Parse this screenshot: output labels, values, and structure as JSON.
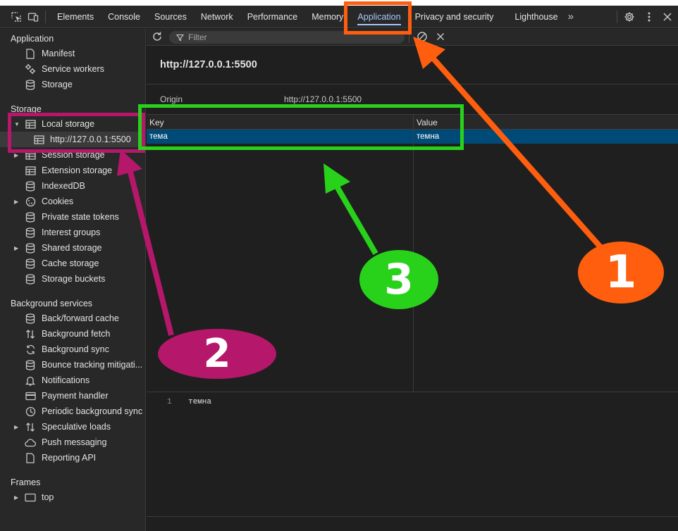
{
  "tabs": [
    {
      "label": "Elements"
    },
    {
      "label": "Console"
    },
    {
      "label": "Sources"
    },
    {
      "label": "Network"
    },
    {
      "label": "Performance"
    },
    {
      "label": "Memory"
    },
    {
      "label": "Application",
      "active": true
    },
    {
      "label": "Privacy and security"
    },
    {
      "label": "Lighthouse"
    }
  ],
  "toolbar": {
    "more_tabs": "»",
    "settings_icon": "gear-icon",
    "menu_icon": "vertical-dots-icon",
    "close_icon": "close-icon"
  },
  "sidebar": {
    "application_title": "Application",
    "application_items": [
      {
        "label": "Manifest",
        "icon": "file-icon"
      },
      {
        "label": "Service workers",
        "icon": "gears-icon"
      },
      {
        "label": "Storage",
        "icon": "database-icon"
      }
    ],
    "storage_title": "Storage",
    "storage_items": [
      {
        "label": "Local storage",
        "icon": "table-icon",
        "expanded": true
      },
      {
        "label": "http://127.0.0.1:5500",
        "icon": "table-icon",
        "selected": true
      },
      {
        "label": "Session storage",
        "icon": "table-icon"
      },
      {
        "label": "Extension storage",
        "icon": "table-icon"
      },
      {
        "label": "IndexedDB",
        "icon": "database-icon"
      },
      {
        "label": "Cookies",
        "icon": "cookie-icon"
      },
      {
        "label": "Private state tokens",
        "icon": "database-icon"
      },
      {
        "label": "Interest groups",
        "icon": "database-icon"
      },
      {
        "label": "Shared storage",
        "icon": "database-icon"
      },
      {
        "label": "Cache storage",
        "icon": "database-icon"
      },
      {
        "label": "Storage buckets",
        "icon": "database-icon"
      }
    ],
    "background_title": "Background services",
    "background_items": [
      {
        "label": "Back/forward cache",
        "icon": "database-icon"
      },
      {
        "label": "Background fetch",
        "icon": "up-down-arrows-icon"
      },
      {
        "label": "Background sync",
        "icon": "sync-icon"
      },
      {
        "label": "Bounce tracking mitigati...",
        "icon": "database-icon"
      },
      {
        "label": "Notifications",
        "icon": "bell-icon"
      },
      {
        "label": "Payment handler",
        "icon": "card-icon"
      },
      {
        "label": "Periodic background sync",
        "icon": "clock-icon"
      },
      {
        "label": "Speculative loads",
        "icon": "up-down-arrows-icon"
      },
      {
        "label": "Push messaging",
        "icon": "cloud-icon"
      },
      {
        "label": "Reporting API",
        "icon": "file-icon"
      }
    ],
    "frames_title": "Frames",
    "frames_items": [
      {
        "label": "top",
        "icon": "window-icon"
      }
    ]
  },
  "main": {
    "filter_placeholder": "Filter",
    "origin_heading": "http://127.0.0.1:5500",
    "origin_label": "Origin",
    "origin_value": "http://127.0.0.1:5500",
    "table": {
      "col_key": "Key",
      "col_value": "Value",
      "rows": [
        {
          "key": "тема",
          "value": "темна"
        }
      ]
    },
    "preview": {
      "line_number": "1",
      "line_text": "темна"
    }
  },
  "annotations": {
    "label_1": "1",
    "label_2": "2",
    "label_3": "3",
    "color_orange": "#ff5e0e",
    "color_magenta": "#b5176b",
    "color_green": "#28d21b"
  }
}
